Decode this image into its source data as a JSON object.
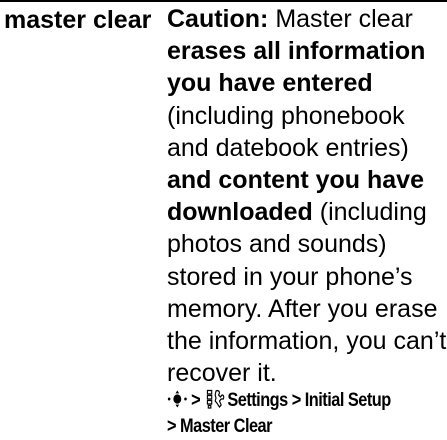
{
  "term": "master clear",
  "description": {
    "caution_label": "Caution:",
    "t1": " Master clear ",
    "b1": "erases all information you have entered",
    "t2": " (including phonebook and datebook entries) ",
    "b2": "and content you have downloaded",
    "t3": " (including photos and sounds) stored in your phone’s memory. After you erase the information, you can’t recover it."
  },
  "path": {
    "sep": ">",
    "settings": "Settings",
    "initial_setup": "Initial Setup",
    "master_clear": "Master Clear"
  },
  "icons": {
    "nav_key": "menu-key-icon",
    "settings": "settings-icon"
  }
}
